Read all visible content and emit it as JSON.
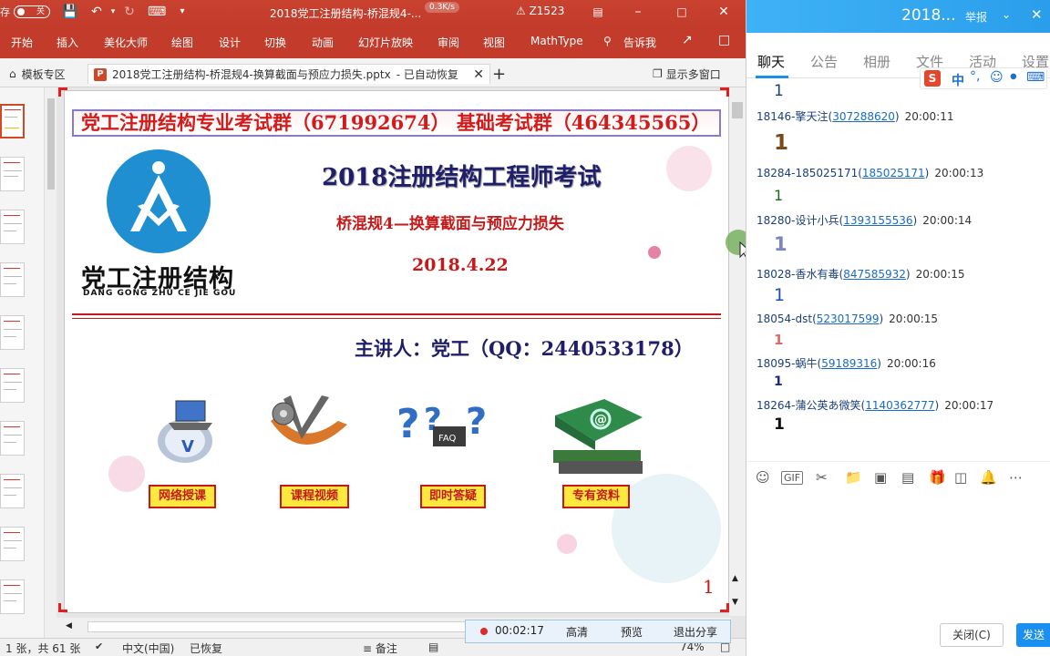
{
  "ppt": {
    "title": "2018党工注册结构-桥混规4-...",
    "autosave_left": "存",
    "autosave_state": "关",
    "speed": "0.3K/s",
    "warning": "Z1523",
    "ribbon_tabs": [
      "开始",
      "插入",
      "美化大师",
      "绘图",
      "设计",
      "切换",
      "动画",
      "幻灯片放映",
      "审阅",
      "视图",
      "MathType",
      "告诉我"
    ],
    "doc_tabs": {
      "template_zone": "模板专区",
      "active": "2018党工注册结构-桥混规4-换算截面与预应力损失.pptx",
      "active_status": "- 已自动恢复",
      "multi_window": "显示多窗口"
    }
  },
  "slide": {
    "banner": "党工注册结构专业考试群（671992674）  基础考试群（464345565）",
    "logo_text": "党工注册结构",
    "logo_pinyin": "DANG GONG ZHU CE JIE GOU",
    "main_title": "2018注册结构工程师考试",
    "subtitle": "桥混规4—换算截面与预应力损失",
    "date": "2018.4.22",
    "presenter": "主讲人：党工（QQ：2440533178）",
    "features": [
      "网络授课",
      "课程视频",
      "即时答疑",
      "专有资料"
    ],
    "page_number": "1"
  },
  "status": {
    "slide_info": "1 张，共 61 张",
    "language": "中文(中国)",
    "recovered": "已恢复",
    "notes": "备注",
    "zoom": "74%"
  },
  "recording": {
    "time": "00:02:17",
    "quality": "高清",
    "preview": "预览",
    "exit": "退出分享"
  },
  "qq": {
    "group_title": "2018...",
    "report": "举报",
    "tabs": [
      "聊天",
      "公告",
      "相册",
      "文件",
      "活动",
      "设置"
    ],
    "messages": [
      {
        "sender": "",
        "qq": "",
        "time": "",
        "text": "1"
      },
      {
        "sender": "18146-擎天注(",
        "qq": "307288620",
        "time": "20:00:11",
        "text": "1"
      },
      {
        "sender": "18284-185025171(",
        "qq": "185025171",
        "time": "20:00:13",
        "text": "1"
      },
      {
        "sender": "18280-设计小兵(",
        "qq": "1393155536",
        "time": "20:00:14",
        "text": "1"
      },
      {
        "sender": "18028-香水有毒(",
        "qq": "847585932",
        "time": "20:00:15",
        "text": "1"
      },
      {
        "sender": "18054-dst(",
        "qq": "523017599",
        "time": "20:00:15",
        "text": "1"
      },
      {
        "sender": "18095-蜗牛(",
        "qq": "59189316",
        "time": "20:00:16",
        "text": "1"
      },
      {
        "sender": "18264-蒲公英あ微笑(",
        "qq": "1140362777",
        "time": "20:00:17",
        "text": "1"
      }
    ],
    "close_label": "关闭(C)",
    "send_label": "发送"
  }
}
